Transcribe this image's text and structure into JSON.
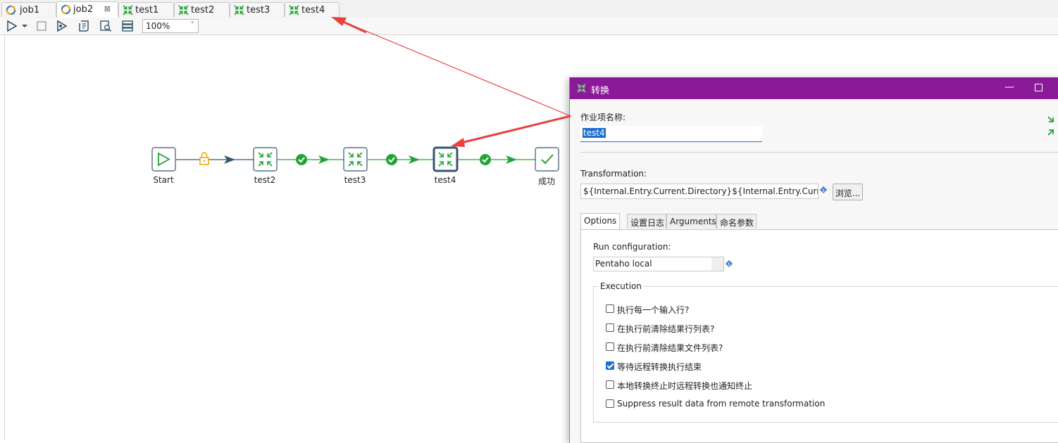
{
  "tabs": [
    {
      "label": "job1",
      "type": "job",
      "active": false,
      "closable": false
    },
    {
      "label": "job2",
      "type": "job",
      "active": true,
      "closable": true
    },
    {
      "label": "test1",
      "type": "transformation",
      "active": false,
      "closable": false
    },
    {
      "label": "test2",
      "type": "transformation",
      "active": false,
      "closable": false
    },
    {
      "label": "test3",
      "type": "transformation",
      "active": false,
      "closable": false
    },
    {
      "label": "test4",
      "type": "transformation",
      "active": false,
      "closable": false
    }
  ],
  "toolbar": {
    "icons": [
      "run-icon",
      "run-dropdown-icon",
      "stop-icon",
      "preview-icon",
      "script-icon",
      "search-icon",
      "layers-icon"
    ],
    "zoom": "100%",
    "zoom_chevron": "˅"
  },
  "canvas": {
    "nodes": [
      {
        "id": "start",
        "label": "Start",
        "icon": "play-icon"
      },
      {
        "id": "test2",
        "label": "test2",
        "icon": "transformation-icon"
      },
      {
        "id": "test3",
        "label": "test3",
        "icon": "transformation-icon"
      },
      {
        "id": "test4",
        "label": "test4",
        "icon": "transformation-icon",
        "selected": true
      },
      {
        "id": "success",
        "label": "成功",
        "icon": "check-icon"
      }
    ],
    "hops": [
      {
        "from": "start",
        "to": "test2",
        "condition": "unconditional",
        "color": "#f0a30a"
      },
      {
        "from": "test2",
        "to": "test3",
        "condition": "success",
        "color": "#22a335"
      },
      {
        "from": "test3",
        "to": "test4",
        "condition": "success",
        "color": "#22a335"
      },
      {
        "from": "test4",
        "to": "success",
        "condition": "success",
        "color": "#22a335"
      }
    ]
  },
  "colors": {
    "dialog_title": "#8a1a97",
    "annotation_arrow": "#e8413f",
    "hop_success": "#22a335",
    "hop_unconditional": "#f0a30a",
    "node_border": "#35566e",
    "selection": "#1f6fd1"
  },
  "dialog": {
    "title": "转换",
    "minimize": "—",
    "job_entry_name_label": "作业项名称:",
    "job_entry_name_value": "test4",
    "transformation_label": "Transformation:",
    "transformation_value": "${Internal.Entry.Current.Directory}${Internal.Entry.Current.Name}",
    "browse_button": "浏览...",
    "tabs": [
      "Options",
      "设置日志",
      "Arguments",
      "命名参数"
    ],
    "run_config_label": "Run configuration:",
    "run_config_value": "Pentaho local",
    "execution_group": "Execution",
    "options": [
      {
        "label": "执行每一个输入行?",
        "checked": false
      },
      {
        "label": "在执行前清除结果行列表?",
        "checked": false
      },
      {
        "label": "在执行前清除结果文件列表?",
        "checked": false
      },
      {
        "label": "等待远程转换执行结束",
        "checked": true
      },
      {
        "label": "本地转换终止时远程转换也通知终止",
        "checked": false
      },
      {
        "label": "Suppress result data from remote transformation",
        "checked": false
      }
    ]
  }
}
